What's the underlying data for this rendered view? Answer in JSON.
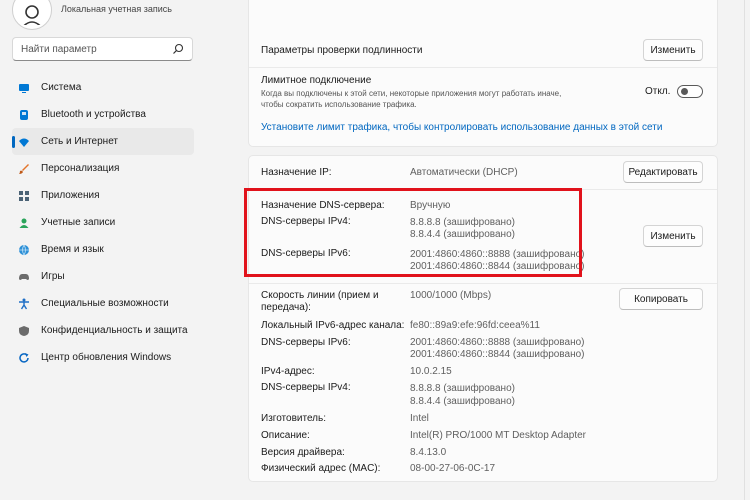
{
  "account": {
    "type": "Локальная учетная запись"
  },
  "search": {
    "placeholder": "Найти параметр"
  },
  "nav": [
    {
      "label": "Система",
      "icon": "monitor-icon",
      "color": "#0078d4"
    },
    {
      "label": "Bluetooth и устройства",
      "icon": "bluetooth-icon",
      "color": "#0078d4"
    },
    {
      "label": "Сеть и Интернет",
      "icon": "wifi-icon",
      "color": "#0078d4",
      "active": true
    },
    {
      "label": "Персонализация",
      "icon": "brush-icon",
      "color": "#e3742a"
    },
    {
      "label": "Приложения",
      "icon": "apps-icon",
      "color": "#4a6275"
    },
    {
      "label": "Учетные записи",
      "icon": "person-icon",
      "color": "#2aa45a"
    },
    {
      "label": "Время и язык",
      "icon": "globe-icon",
      "color": "#2c8fd6"
    },
    {
      "label": "Игры",
      "icon": "gamepad-icon",
      "color": "#6b6b6b"
    },
    {
      "label": "Специальные возможности",
      "icon": "accessibility-icon",
      "color": "#1f6fc6"
    },
    {
      "label": "Конфиденциальность и защита",
      "icon": "shield-icon",
      "color": "#6b6b6b"
    },
    {
      "label": "Центр обновления Windows",
      "icon": "update-icon",
      "color": "#0a68c3"
    }
  ],
  "group1": {
    "auth_label": "Параметры проверки подлинности",
    "auth_button": "Изменить",
    "metered_title": "Лимитное подключение",
    "metered_desc_line1": "Когда вы подключены к этой сети, некоторые приложения могут работать иначе,",
    "metered_desc_line2": "чтобы сократить использование трафика.",
    "metered_state": "Откл.",
    "metered_on": false,
    "data_limit_link": "Установите лимит трафика, чтобы контролировать использование данных в этой сети"
  },
  "ip": {
    "label": "Назначение IP:",
    "value": "Автоматически (DHCP)",
    "button": "Редактировать"
  },
  "dns": {
    "assign_label": "Назначение DNS-сервера:",
    "assign_value": "Вручную",
    "ipv4_label": "DNS-серверы IPv4:",
    "ipv4_1": "8.8.8.8 (зашифровано)",
    "ipv4_2": "8.8.4.4 (зашифровано)",
    "ipv6_label": "DNS-серверы IPv6:",
    "ipv6_1": "2001:4860:4860::8888 (зашифровано)",
    "ipv6_2": "2001:4860:4860::8844 (зашифровано)",
    "button": "Изменить"
  },
  "props": {
    "speed_label_1": "Скорость линии (прием и",
    "speed_label_2": "передача):",
    "speed_value": "1000/1000 (Mbps)",
    "copy_button": "Копировать",
    "ipv6_local_label": "Локальный IPv6-адрес канала:",
    "ipv6_local_value": "fe80::89a9:efe:96fd:ceea%11",
    "dns6_label": "DNS-серверы IPv6:",
    "dns6_1": "2001:4860:4860::8888 (зашифровано)",
    "dns6_2": "2001:4860:4860::8844 (зашифровано)",
    "ipv4_label": "IPv4-адрес:",
    "ipv4_value": "10.0.2.15",
    "dns4_label": "DNS-серверы IPv4:",
    "dns4_1": "8.8.8.8 (зашифровано)",
    "dns4_2": "8.8.4.4 (зашифровано)",
    "manufacturer_label": "Изготовитель:",
    "manufacturer_value": "Intel",
    "description_label": "Описание:",
    "description_value": "Intel(R) PRO/1000 MT Desktop Adapter",
    "driver_label": "Версия драйвера:",
    "driver_value": "8.4.13.0",
    "mac_label": "Физический адрес (MAC):",
    "mac_value": "08-00-27-06-0C-17"
  },
  "colors": {
    "accent": "#0067c0",
    "highlight_box": "#e1121b"
  }
}
